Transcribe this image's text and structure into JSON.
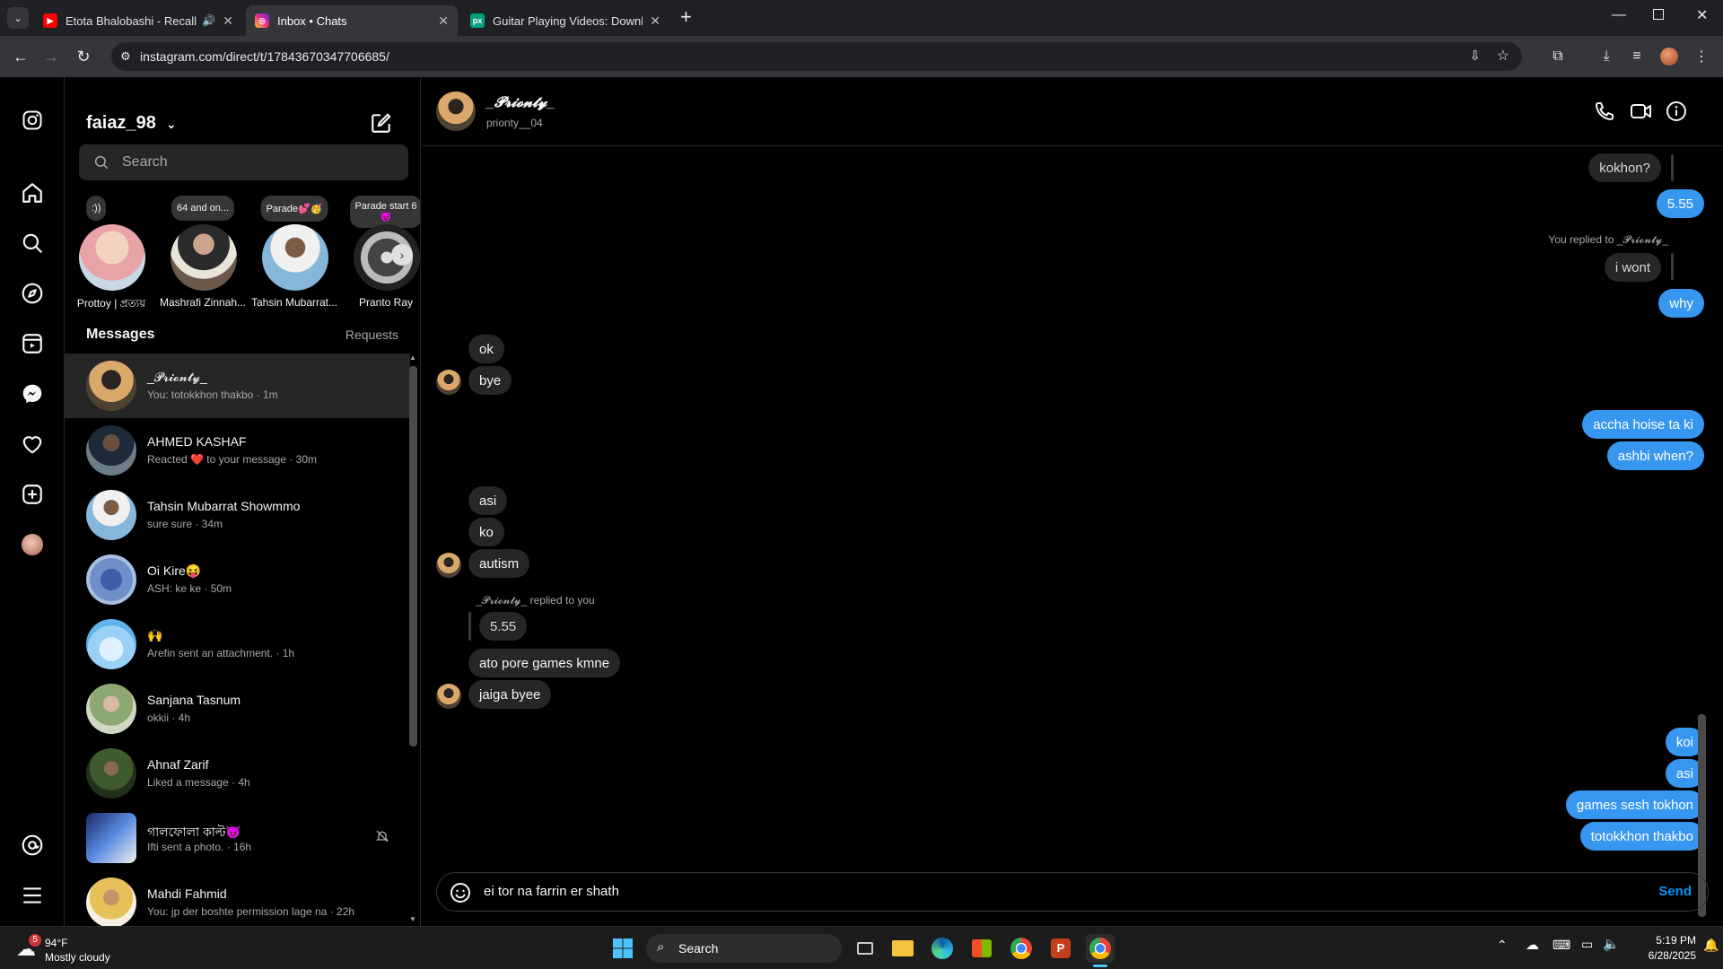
{
  "browser": {
    "tabs": [
      {
        "title": "Etota Bhalobashi - Recall || C",
        "icon": "youtube-icon",
        "color": "#ff0000"
      },
      {
        "title": "Inbox • Chats",
        "icon": "instagram-icon",
        "color": "#e1306c"
      },
      {
        "title": "Guitar Playing Videos: Downlo",
        "icon": "pexels-icon",
        "color": "#05a081"
      }
    ],
    "url": "instagram.com/direct/t/17843670347706685/"
  },
  "inbox": {
    "username": "faiaz_98",
    "search_placeholder": "Search",
    "stories": [
      {
        "note": ":))",
        "name": "Prottoy | প্রত্যয়"
      },
      {
        "note": "64 and on...",
        "name": "Mashrafi Zinnah..."
      },
      {
        "note": "Parade💕🥳",
        "name": "Tahsin Mubarrat..."
      },
      {
        "note": "Parade start 6 😈",
        "name": "Pranto Ray"
      }
    ],
    "messages_label": "Messages",
    "requests_label": "Requests",
    "conversations": [
      {
        "name": "_𝓟𝓻𝓲𝓸𝓷𝓽𝔂_",
        "preview": "You: totokkhon thakbo · 1m"
      },
      {
        "name": "AHMED KASHAF",
        "preview": "Reacted ❤️ to your message · 30m"
      },
      {
        "name": "Tahsin Mubarrat Showmmo",
        "preview": "sure sure · 34m"
      },
      {
        "name": "Oi Kire😝",
        "preview": "ASH: ke ke · 50m"
      },
      {
        "name": "🙌",
        "preview": "Arefin sent an attachment. · 1h"
      },
      {
        "name": "Sanjana Tasnum",
        "preview": "okkii · 4h"
      },
      {
        "name": "Ahnaf Zarif",
        "preview": "Liked a message · 4h"
      },
      {
        "name": "গালফোলা কাল্ট😈",
        "preview": "Ifti sent a photo. · 16h"
      },
      {
        "name": "Mahdi Fahmid",
        "preview": "You: jp der boshte permission lage na · 22h"
      }
    ]
  },
  "chat": {
    "contact_name": "_𝓟𝓻𝓲𝓸𝓷𝓽𝔂_",
    "contact_handle": "prionty__04",
    "reply_note_out": "You replied to _𝓟𝓻𝓲𝓸𝓷𝓽𝔂_",
    "reply_note_in": "_𝓟𝓻𝓲𝓸𝓷𝓽𝔂_ replied to you",
    "messages": [
      {
        "text": "kokhon?",
        "dir": "quoted"
      },
      {
        "text": "5.55",
        "dir": "out"
      },
      {
        "text": "i wont",
        "dir": "quoted"
      },
      {
        "text": "why",
        "dir": "out"
      },
      {
        "text": "ok",
        "dir": "in"
      },
      {
        "text": "bye",
        "dir": "in"
      },
      {
        "text": "accha hoise ta ki",
        "dir": "out"
      },
      {
        "text": "ashbi when?",
        "dir": "out"
      },
      {
        "text": "asi",
        "dir": "in"
      },
      {
        "text": "ko",
        "dir": "in"
      },
      {
        "text": "autism",
        "dir": "in"
      },
      {
        "text": "5.55",
        "dir": "quoted"
      },
      {
        "text": "ato pore games kmne",
        "dir": "in"
      },
      {
        "text": "jaiga byee",
        "dir": "in"
      },
      {
        "text": "koi",
        "dir": "out"
      },
      {
        "text": "asi",
        "dir": "out"
      },
      {
        "text": "games sesh tokhon",
        "dir": "out"
      },
      {
        "text": "totokkhon thakbo",
        "dir": "out"
      }
    ],
    "composer_text": "ei tor na farrin er shath",
    "send_label": "Send"
  },
  "taskbar": {
    "weather_temp": "94°F",
    "weather_desc": "Mostly cloudy",
    "weather_badge": "5",
    "search_label": "Search",
    "time": "5:19 PM",
    "date": "6/28/2025"
  },
  "colors": {
    "outgoing": "#3797f0",
    "incoming": "#262626",
    "link": "#0095f6"
  }
}
